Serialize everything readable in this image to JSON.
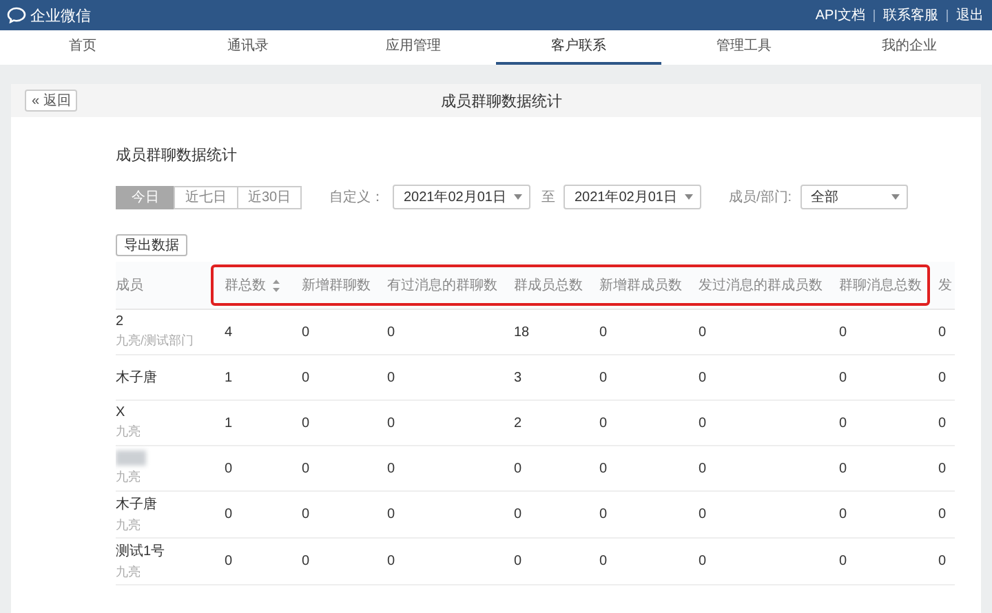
{
  "topbar": {
    "logo": "企业微信",
    "links": [
      "API文档",
      "联系客服",
      "退出"
    ]
  },
  "nav": [
    {
      "label": "首页",
      "selected": false
    },
    {
      "label": "通讯录",
      "selected": false
    },
    {
      "label": "应用管理",
      "selected": false
    },
    {
      "label": "客户联系",
      "selected": true
    },
    {
      "label": "管理工具",
      "selected": false
    },
    {
      "label": "我的企业",
      "selected": false
    }
  ],
  "header": {
    "back": "« 返回",
    "title": "成员群聊数据统计"
  },
  "section_title": "成员群聊数据统计",
  "periods": [
    {
      "label": "今日",
      "selected": true
    },
    {
      "label": "近七日",
      "selected": false
    },
    {
      "label": "近30日",
      "selected": false
    }
  ],
  "custom_label": "自定义：",
  "date_from": "2021年02月01日",
  "to_label": "至",
  "date_to": "2021年02月01日",
  "member_label": "成员/部门:",
  "member_value": "全部",
  "export_button": "导出数据",
  "table": {
    "columns": [
      {
        "label": "成员"
      }
    ],
    "highlighted_columns": [
      {
        "label": "群总数",
        "sortable": true
      },
      {
        "label": "新增群聊数"
      },
      {
        "label": "有过消息的群聊数"
      },
      {
        "label": "群成员总数"
      },
      {
        "label": "新增群成员数"
      },
      {
        "label": "发过消息的群成员数"
      },
      {
        "label": "群聊消息总数"
      }
    ],
    "trailing_columns": [
      {
        "label": "发"
      }
    ],
    "rows": [
      {
        "kind": "named",
        "name": "2",
        "dept": "九亮/测试部门",
        "values": [
          "4",
          "0",
          "0",
          "18",
          "0",
          "0",
          "0",
          "0"
        ]
      },
      {
        "kind": "named",
        "name": "木子唐",
        "values": [
          "1",
          "0",
          "0",
          "3",
          "0",
          "0",
          "0",
          "0"
        ]
      },
      {
        "kind": "named",
        "name": "X",
        "dept": "九亮",
        "values": [
          "1",
          "0",
          "0",
          "2",
          "0",
          "0",
          "0",
          "0"
        ]
      },
      {
        "kind": "redacted",
        "dept": "九亮",
        "values": [
          "0",
          "0",
          "0",
          "0",
          "0",
          "0",
          "0",
          "0"
        ]
      },
      {
        "kind": "named",
        "name": "木子唐",
        "dept": "九亮",
        "values": [
          "0",
          "0",
          "0",
          "0",
          "0",
          "0",
          "0",
          "0"
        ]
      },
      {
        "kind": "named",
        "name": "测试1号",
        "dept": "九亮",
        "values": [
          "0",
          "0",
          "0",
          "0",
          "0",
          "0",
          "0",
          "0"
        ]
      }
    ]
  }
}
